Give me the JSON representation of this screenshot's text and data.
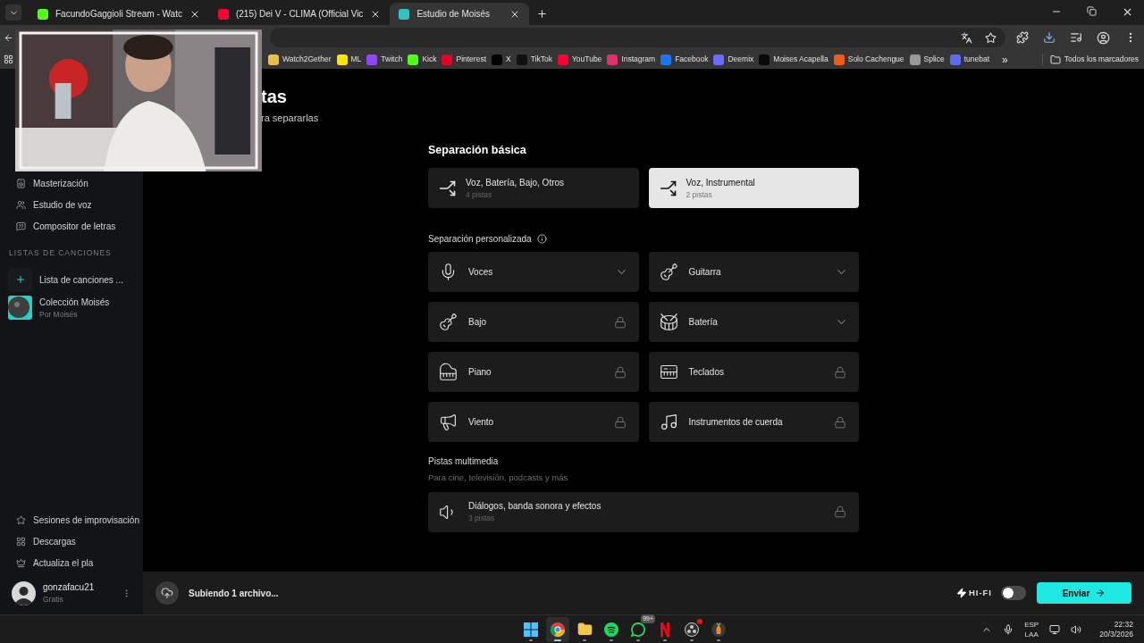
{
  "browser": {
    "tabs": [
      {
        "title": "FacundoGaggioli Stream - Watc",
        "color": "#53fc18",
        "selected": false
      },
      {
        "title": "(215) Dei V - CLIMA (Official Vic",
        "color": "#ff0033",
        "selected": false
      },
      {
        "title": "Estudio de Moisés",
        "color": "#2fc5c0",
        "selected": true
      }
    ],
    "bookmarks": [
      {
        "label": "Watch2Gether",
        "color": "#e8c14a"
      },
      {
        "label": "ML",
        "color": "#ffe600"
      },
      {
        "label": "Twitch",
        "color": "#9146ff"
      },
      {
        "label": "Kick",
        "color": "#53fc18"
      },
      {
        "label": "Pinterest",
        "color": "#e60023"
      },
      {
        "label": "X",
        "color": "#000000"
      },
      {
        "label": "TikTok",
        "color": "#111111"
      },
      {
        "label": "YouTube",
        "color": "#ff0033"
      },
      {
        "label": "Instagram",
        "color": "#e1306c"
      },
      {
        "label": "Facebook",
        "color": "#1877f2"
      },
      {
        "label": "Deemix",
        "color": "#6a6aff"
      },
      {
        "label": "Moises Acapella",
        "color": "#0a0a0a"
      },
      {
        "label": "Solo Cachengue",
        "color": "#f05a1a"
      },
      {
        "label": "Splice",
        "color": "#9a9a9a"
      },
      {
        "label": "tunebat",
        "color": "#5a6cf0"
      }
    ],
    "more": "»",
    "all_bookmarks": "Todos los marcadores"
  },
  "sidebar": {
    "items": [
      {
        "label": "Masterización",
        "kind": "speaker"
      },
      {
        "label": "Estudio de voz",
        "kind": "voice"
      },
      {
        "label": "Compositor de letras",
        "kind": "lyrics"
      }
    ],
    "section_title": "LISTAS DE CANCIONES",
    "playlists": [
      {
        "kind": "new",
        "title": "Lista de canciones ..."
      },
      {
        "kind": "collection",
        "title": "Colección Moisés",
        "subtitle": "Por Moisés"
      }
    ],
    "bottom_items": [
      {
        "label": "Sesiones de improvisación",
        "kind": "star"
      },
      {
        "label": "Descargas",
        "kind": "grid"
      },
      {
        "label": "Actualiza el pla",
        "kind": "crown"
      }
    ],
    "user": {
      "name": "gonzafacu21",
      "plan": "Gratis"
    }
  },
  "page": {
    "title": "tas",
    "subtitle": "ra separarlas",
    "basic": {
      "title": "Separación básica",
      "options": [
        {
          "label": "Voz, Batería, Bajo, Otros",
          "tracks": "4 pistas",
          "selected": false
        },
        {
          "label": "Voz, Instrumental",
          "tracks": "2 pistas",
          "selected": true
        }
      ]
    },
    "custom": {
      "title": "Separación personalizada",
      "items": [
        {
          "label": "Voces",
          "kind": "mic",
          "locked": false
        },
        {
          "label": "Guitarra",
          "kind": "guitar",
          "locked": false
        },
        {
          "label": "Bajo",
          "kind": "bass",
          "locked": true
        },
        {
          "label": "Batería",
          "kind": "drum",
          "locked": false
        },
        {
          "label": "Piano",
          "kind": "piano",
          "locked": true
        },
        {
          "label": "Teclados",
          "kind": "keys",
          "locked": true
        },
        {
          "label": "Viento",
          "kind": "wind",
          "locked": true
        },
        {
          "label": "Instrumentos de cuerda",
          "kind": "strings",
          "locked": true
        }
      ]
    },
    "multimedia": {
      "title": "Pistas multimedia",
      "subtitle": "Para cine, televisión, podcasts y más",
      "items": [
        {
          "label": "Diálogos, banda sonora y efectos",
          "tracks": "3 pistas",
          "locked": true
        }
      ]
    }
  },
  "footer": {
    "status": "Subiendo 1 archivo...",
    "hifi_label": "HI-FI",
    "hifi_on": false,
    "send": "Enviar"
  },
  "taskbar": {
    "apps": [
      {
        "kind": "start",
        "active": false
      },
      {
        "kind": "browser",
        "active": true
      },
      {
        "kind": "folder",
        "active": false
      },
      {
        "kind": "music",
        "active": false
      },
      {
        "kind": "chat",
        "active": false,
        "badge": "99+"
      },
      {
        "kind": "video",
        "active": false
      },
      {
        "kind": "recorder",
        "active": false,
        "dot": true
      },
      {
        "kind": "fruit",
        "active": false
      }
    ],
    "lang": [
      "ESP",
      "LAA"
    ],
    "time": "22:32",
    "date": "20/3/2026"
  }
}
